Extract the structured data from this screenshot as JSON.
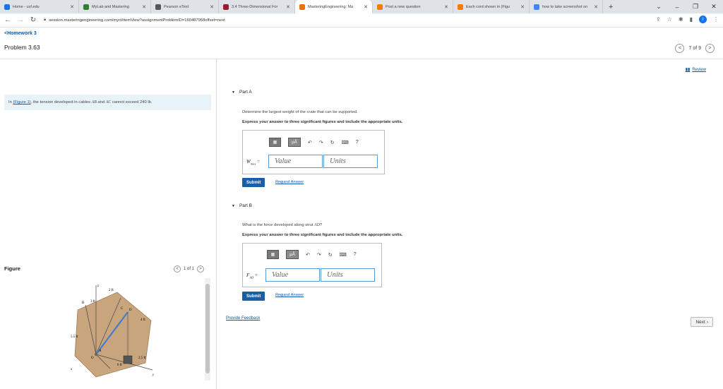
{
  "browser": {
    "tabs": [
      {
        "label": "Home - usf.edu",
        "color": "#1a73e8",
        "active": false
      },
      {
        "label": "MyLab and Mastering",
        "color": "#2e7d32",
        "active": false
      },
      {
        "label": "Pearson eText",
        "color": "#555555",
        "active": false
      },
      {
        "label": "3.4 Three-Dimensional For",
        "color": "#9b1c31",
        "active": false
      },
      {
        "label": "MasteringEngineering: Ma",
        "color": "#e8710a",
        "active": true
      },
      {
        "label": "Post a new question",
        "color": "#f57c00",
        "active": false
      },
      {
        "label": "Each cord shown in (Figu",
        "color": "#f57c00",
        "active": false
      },
      {
        "label": "how to take screenshot on",
        "color": "#4285f4",
        "active": false
      }
    ],
    "new_tab": "+",
    "url": "session.masteringengineering.com/myct/itemView?assignmentProblemID=160487958offset=next",
    "profile_initial": "l"
  },
  "header": {
    "back_label": "<Homework 3",
    "problem_title": "Problem 3.63",
    "pager_text": "7 of 9",
    "review_label": "Review"
  },
  "statement": {
    "prefix": "In ",
    "figure_link": "(Figure 1)",
    "text_a": ", the tension developed in cables ",
    "var_ab": "AB",
    "text_b": " and ",
    "var_ac": "AC",
    "text_c": " cannot exceed 240 lb."
  },
  "figure": {
    "title": "Figure",
    "pager_text": "1 of 1",
    "labels": {
      "dim_2ft": "2 ft",
      "dim_3ft": "3 ft",
      "dim_4ft": "4 ft",
      "dim_55ft": "5.5 ft",
      "dim_25ft": "2.5 ft",
      "dim_6ft": "6 ft",
      "pt_a": "A",
      "pt_b": "B",
      "pt_c": "C",
      "pt_d": "D",
      "pt_o": "O",
      "ax_x": "x",
      "ax_y": "y",
      "ax_z": "z"
    }
  },
  "partA": {
    "title": "Part A",
    "question": "Determine the largest weight of the crate that can be supported.",
    "instruction": "Express your answer to three significant figures and include the appropriate units.",
    "var_main": "W",
    "var_sub": "max",
    "equals": "=",
    "value_placeholder": "Value",
    "units_placeholder": "Units",
    "submit_label": "Submit",
    "request_label": "Request Answer"
  },
  "partB": {
    "title": "Part B",
    "question_prefix": "What is the force developed along strut ",
    "question_var": "AD",
    "question_suffix": "?",
    "instruction": "Express your answer to three significant figures and include the appropriate units.",
    "var_main": "F",
    "var_sub": "AD",
    "equals": "=",
    "value_placeholder": "Value",
    "units_placeholder": "Units",
    "submit_label": "Submit",
    "request_label": "Request Answer"
  },
  "toolbar": {
    "mu_label": "μÅ",
    "help_label": "?"
  },
  "footer": {
    "feedback_label": "Provide Feedback",
    "next_label": "Next"
  }
}
